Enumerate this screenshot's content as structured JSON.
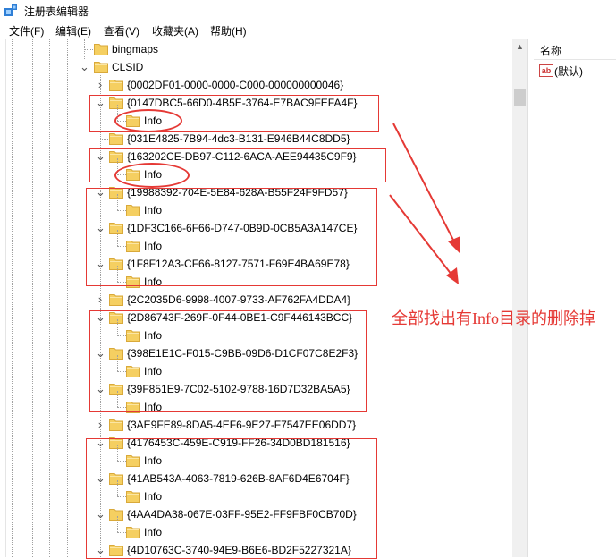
{
  "window": {
    "title": "注册表编辑器",
    "icon_name": "regedit-icon"
  },
  "menu": {
    "items": [
      "文件(F)",
      "编辑(E)",
      "查看(V)",
      "收藏夹(A)",
      "帮助(H)"
    ]
  },
  "tree": {
    "nodes": [
      {
        "label": "bingmaps",
        "toggle": ""
      },
      {
        "label": "CLSID",
        "toggle": "v"
      },
      {
        "label": "{0002DF01-0000-0000-C000-000000000046}",
        "toggle": ">"
      },
      {
        "label": "{0147DBC5-66D0-4B5E-3764-E7BAC9FEFA4F}",
        "toggle": "v"
      },
      {
        "label": "Info",
        "toggle": ""
      },
      {
        "label": "{031E4825-7B94-4dc3-B131-E946B44C8DD5}",
        "toggle": ""
      },
      {
        "label": "{163202CE-DB97-C112-6ACA-AEE94435C9F9}",
        "toggle": "v"
      },
      {
        "label": "Info",
        "toggle": ""
      },
      {
        "label": "{19988392-704E-5E84-628A-B55F24F9FD57}",
        "toggle": "v"
      },
      {
        "label": "Info",
        "toggle": ""
      },
      {
        "label": "{1DF3C166-6F66-D747-0B9D-0CB5A3A147CE}",
        "toggle": "v"
      },
      {
        "label": "Info",
        "toggle": ""
      },
      {
        "label": "{1F8F12A3-CF66-8127-7571-F69E4BA69E78}",
        "toggle": "v"
      },
      {
        "label": "Info",
        "toggle": ""
      },
      {
        "label": "{2C2035D6-9998-4007-9733-AF762FA4DDA4}",
        "toggle": ">"
      },
      {
        "label": "{2D86743F-269F-0F44-0BE1-C9F446143BCC}",
        "toggle": "v"
      },
      {
        "label": "Info",
        "toggle": ""
      },
      {
        "label": "{398E1E1C-F015-C9BB-09D6-D1CF07C8E2F3}",
        "toggle": "v"
      },
      {
        "label": "Info",
        "toggle": ""
      },
      {
        "label": "{39F851E9-7C02-5102-9788-16D7D32BA5A5}",
        "toggle": "v"
      },
      {
        "label": "Info",
        "toggle": ""
      },
      {
        "label": "{3AE9FE89-8DA5-4EF6-9E27-F7547EE06DD7}",
        "toggle": ">"
      },
      {
        "label": "{4176453C-459E-C919-FF26-34D0BD181516}",
        "toggle": "v"
      },
      {
        "label": "Info",
        "toggle": ""
      },
      {
        "label": "{41AB543A-4063-7819-626B-8AF6D4E6704F}",
        "toggle": "v"
      },
      {
        "label": "Info",
        "toggle": ""
      },
      {
        "label": "{4AA4DA38-067E-03FF-95E2-FF9FBF0CB70D}",
        "toggle": "v"
      },
      {
        "label": "Info",
        "toggle": ""
      },
      {
        "label": "{4D10763C-3740-94E9-B6E6-BD2F5227321A}",
        "toggle": "v"
      }
    ]
  },
  "list": {
    "column_name": "名称",
    "values": [
      {
        "icon": "ab-icon",
        "name": "(默认)"
      }
    ]
  },
  "annotation": {
    "text": "全部找出有Info目录的删除掉",
    "color": "#e53935"
  },
  "colors": {
    "folder": "#f5cf61",
    "folder_dark": "#d9a93a",
    "annotation_red": "#e53935"
  }
}
